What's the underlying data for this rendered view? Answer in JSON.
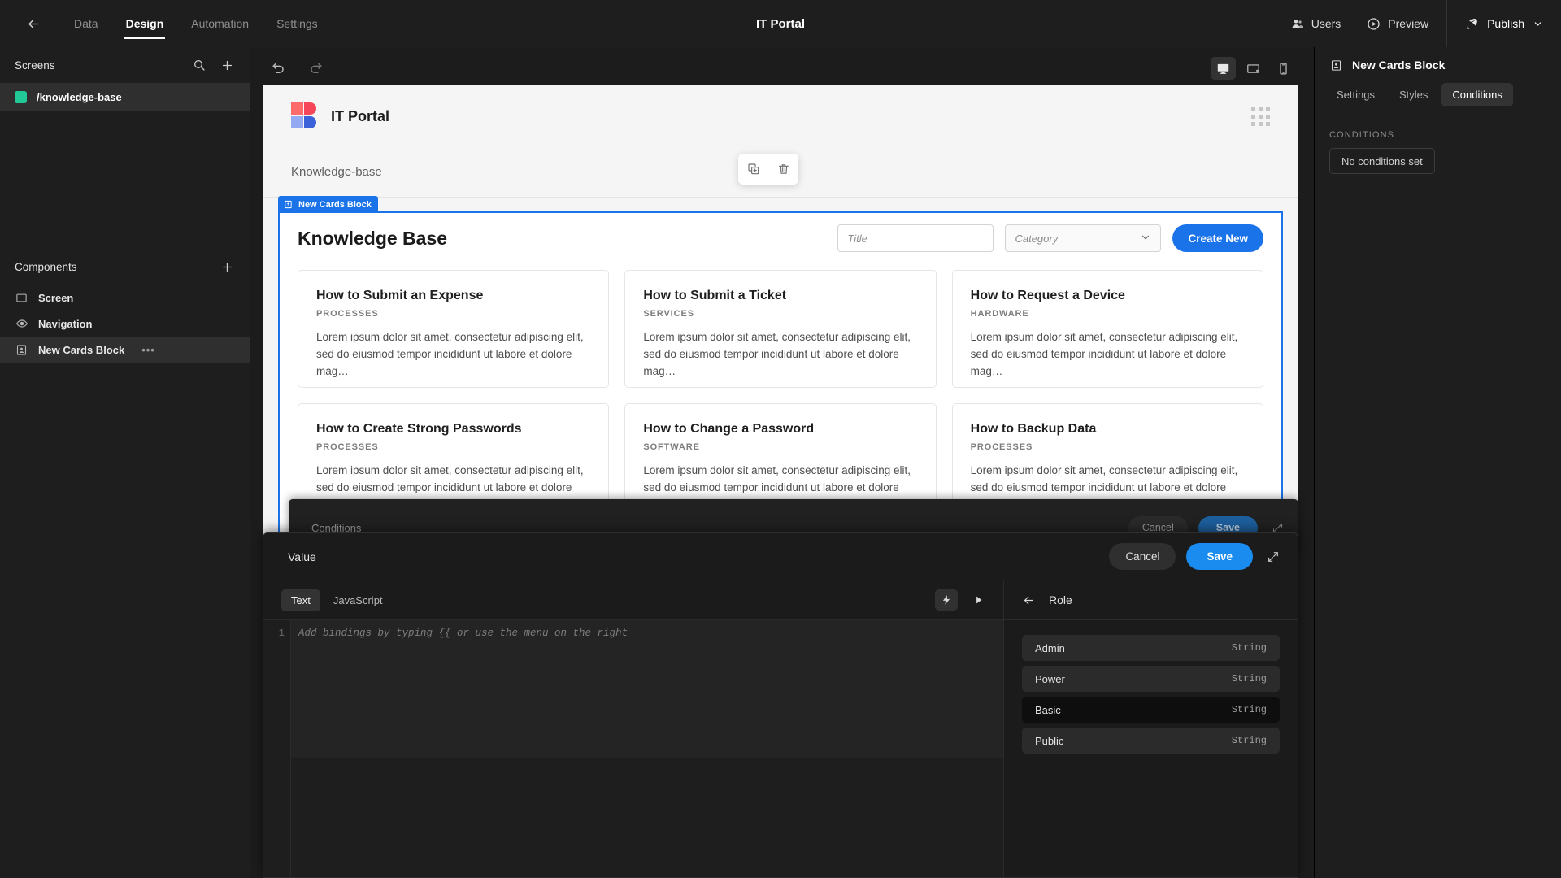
{
  "topbar": {
    "back_icon": "arrow-left-icon",
    "tabs": [
      {
        "label": "Data",
        "active": false
      },
      {
        "label": "Design",
        "active": true
      },
      {
        "label": "Automation",
        "active": false
      },
      {
        "label": "Settings",
        "active": false
      }
    ],
    "title": "IT Portal",
    "users_label": "Users",
    "preview_label": "Preview",
    "publish_label": "Publish"
  },
  "sidebar": {
    "screens_label": "Screens",
    "screens": [
      {
        "label": "/knowledge-base",
        "color": "#20c997",
        "active": true
      }
    ],
    "components_label": "Components",
    "components": [
      {
        "label": "Screen",
        "icon": "screen-icon",
        "active": false
      },
      {
        "label": "Navigation",
        "icon": "eye-icon",
        "active": false
      },
      {
        "label": "New Cards Block",
        "icon": "cards-block-icon",
        "active": true,
        "more": "•••"
      }
    ]
  },
  "canvas_toolbar": {
    "undo_icon": "undo-icon",
    "redo_icon": "redo-icon",
    "devices": [
      {
        "name": "desktop",
        "active": true
      },
      {
        "name": "tablet",
        "active": false
      },
      {
        "name": "mobile",
        "active": false
      }
    ]
  },
  "preview": {
    "app_name": "IT Portal",
    "breadcrumb": "Knowledge-base",
    "hover_toolbar": {
      "duplicate": "duplicate-icon",
      "delete": "trash-icon"
    },
    "block_tag": "New Cards Block",
    "heading": "Knowledge Base",
    "title_input_placeholder": "Title",
    "title_input_value": "",
    "category_select_placeholder": "Category",
    "create_button": "Create New",
    "cards": [
      {
        "title": "How to Submit an Expense",
        "category": "PROCESSES",
        "body": "Lorem ipsum dolor sit amet, consectetur adipiscing elit, sed do eiusmod tempor incididunt ut labore et dolore mag…"
      },
      {
        "title": "How to Submit a Ticket",
        "category": "SERVICES",
        "body": "Lorem ipsum dolor sit amet, consectetur adipiscing elit, sed do eiusmod tempor incididunt ut labore et dolore mag…"
      },
      {
        "title": "How to Request a Device",
        "category": "HARDWARE",
        "body": "Lorem ipsum dolor sit amet, consectetur adipiscing elit, sed do eiusmod tempor incididunt ut labore et dolore mag…"
      },
      {
        "title": "How to Create Strong Passwords",
        "category": "PROCESSES",
        "body": "Lorem ipsum dolor sit amet, consectetur adipiscing elit, sed do eiusmod tempor incididunt ut labore et dolore mag…"
      },
      {
        "title": "How to Change a Password",
        "category": "SOFTWARE",
        "body": "Lorem ipsum dolor sit amet, consectetur adipiscing elit, sed do eiusmod tempor incididunt ut labore et dolore mag…"
      },
      {
        "title": "How to Backup Data",
        "category": "PROCESSES",
        "body": "Lorem ipsum dolor sit amet, consectetur adipiscing elit, sed do eiusmod tempor incididunt ut labore et dolore mag…"
      }
    ]
  },
  "rightpanel": {
    "block_title": "New Cards Block",
    "tabs": [
      {
        "label": "Settings",
        "active": false
      },
      {
        "label": "Styles",
        "active": false
      },
      {
        "label": "Conditions",
        "active": true
      }
    ],
    "section_label": "CONDITIONS",
    "empty_button": "No conditions set"
  },
  "drawer_back": {
    "title": "Conditions",
    "cancel": "Cancel",
    "save": "Save"
  },
  "drawer_front": {
    "title": "Value",
    "cancel": "Cancel",
    "save": "Save",
    "expand_icon": "expand-icon",
    "editor_tabs": [
      {
        "label": "Text",
        "active": true
      },
      {
        "label": "JavaScript",
        "active": false
      }
    ],
    "lightning_icon": "lightning-icon",
    "run_icon": "play-icon",
    "line_number": "1",
    "code_placeholder": "Add bindings by typing {{ or use the menu on the right",
    "binding_panel_title": "Role",
    "bindings": [
      {
        "name": "Admin",
        "type": "String",
        "hover": false
      },
      {
        "name": "Power",
        "type": "String",
        "hover": false
      },
      {
        "name": "Basic",
        "type": "String",
        "hover": true
      },
      {
        "name": "Public",
        "type": "String",
        "hover": false
      }
    ]
  },
  "colors": {
    "accent_blue": "#1a73e8",
    "save_blue": "#1a8cf0",
    "screen_green": "#20c997",
    "logo_red": "#ff5b5b",
    "logo_blue": "#7c9cf0"
  }
}
